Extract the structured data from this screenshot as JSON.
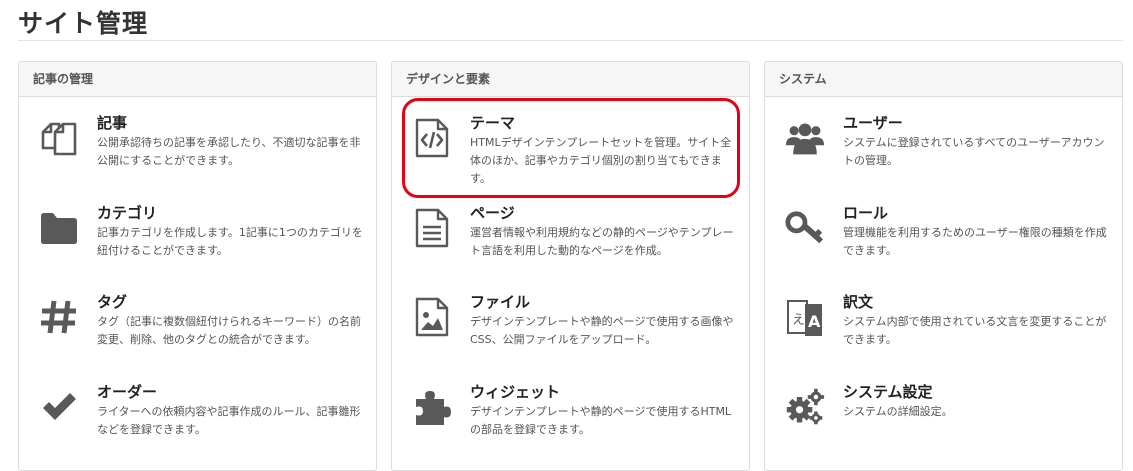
{
  "page": {
    "title": "サイト管理"
  },
  "columns": [
    {
      "header": "記事の管理",
      "items": [
        {
          "name": "記事",
          "desc": "公開承認待ちの記事を承認したり、不適切な記事を非公開にすることができます。",
          "icon": "copy-icon"
        },
        {
          "name": "カテゴリ",
          "desc": "記事カテゴリを作成します。1記事に1つのカテゴリを紐付けることができます。",
          "icon": "folder-icon"
        },
        {
          "name": "タグ",
          "desc": "タグ（記事に複数個紐付けられるキーワード）の名前変更、削除、他のタグとの統合ができます。",
          "icon": "hash-icon"
        },
        {
          "name": "オーダー",
          "desc": "ライターへの依頼内容や記事作成のルール、記事雛形などを登録できます。",
          "icon": "check-icon"
        }
      ]
    },
    {
      "header": "デザインと要素",
      "items": [
        {
          "name": "テーマ",
          "desc": "HTMLデザインテンプレートセットを管理。サイト全体のほか、記事やカテゴリ個別の割り当てもできます。",
          "icon": "code-file-icon"
        },
        {
          "name": "ページ",
          "desc": "運営者情報や利用規約などの静的ページやテンプレート言語を利用した動的なページを作成。",
          "icon": "document-icon"
        },
        {
          "name": "ファイル",
          "desc": "デザインテンプレートや静的ページで使用する画像やCSS、公開ファイルをアップロード。",
          "icon": "image-file-icon"
        },
        {
          "name": "ウィジェット",
          "desc": "デザインテンプレートや静的ページで使用するHTMLの部品を登録できます。",
          "icon": "puzzle-icon"
        }
      ]
    },
    {
      "header": "システム",
      "items": [
        {
          "name": "ユーザー",
          "desc": "システムに登録されているすべてのユーザーアカウントの管理。",
          "icon": "users-icon"
        },
        {
          "name": "ロール",
          "desc": "管理機能を利用するためのユーザー権限の種類を作成できます。",
          "icon": "key-icon"
        },
        {
          "name": "訳文",
          "desc": "システム内部で使用されている文言を変更することができます。",
          "icon": "translate-icon"
        },
        {
          "name": "システム設定",
          "desc": "システムの詳細設定。",
          "icon": "gears-icon"
        }
      ]
    }
  ],
  "colors": {
    "highlight": "#e60012",
    "icon": "#595959"
  }
}
